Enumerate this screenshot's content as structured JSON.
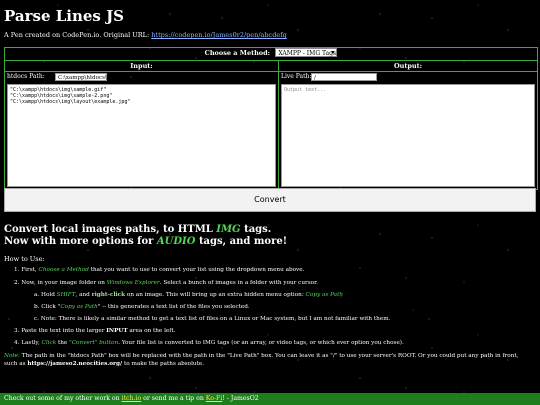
{
  "title": "Parse Lines JS",
  "credit": {
    "text": "A Pen created on CodePen.io. Original URL:",
    "url_text": "https://codepen.io/James0r2/pen/abcdefg"
  },
  "method": {
    "label": "Choose a Method:",
    "selected": "XAMPP - IMG Tags"
  },
  "input": {
    "header": "Input:",
    "path_label": "htdocs Path:",
    "path_value": "C:\\xampp\\htdocs\\",
    "lines": [
      "\"C:\\xampp\\htdocs\\img\\sample.gif\"",
      "\"C:\\xampp\\htdocs\\img\\sample-2.png\"",
      "\"C:\\xampp\\htdocs\\img\\layout\\example.jpg\""
    ]
  },
  "output": {
    "header": "Output:",
    "path_label": "Live Path:",
    "path_value": "/",
    "placeholder": "Output text..."
  },
  "convert_label": "Convert",
  "headline": {
    "line1_a": "Convert local images paths, to HTML",
    "line1_em": "IMG",
    "line1_b": "tags.",
    "line2_a": "Now with more options for",
    "line2_em": "AUDIO",
    "line2_b": "tags, and more!"
  },
  "how_to_use": "How to Use:",
  "steps": {
    "s1_a": "1. First,",
    "s1_em": "Choose a Method",
    "s1_b": "that you want to use to convert your list using the dropdown menu above.",
    "s2_a": "2. Now, in your image folder on",
    "s2_em": "Windows Explorer",
    "s2_b": ". Select a bunch of images in a folder with your cursor.",
    "sa_a": "a. Hold",
    "sa_key": "SHIFT",
    "sa_b": ", and",
    "sa_rc": "right-click",
    "sa_c": "on an image. This will bring up an extra hidden menu option:",
    "sa_em": "Copy as Path",
    "sb_a": "b. Click \"",
    "sb_em": "Copy as Path",
    "sb_b": "\" -- this generates a text list of the files you selected.",
    "sc": "c. Note: There is likely a similar method to get a text list of files on a Linux or Mac system, but I am not familiar with them.",
    "s3_a": "3. Paste the text into the larger",
    "s3_b": "INPUT",
    "s3_c": "area on the left.",
    "s4_a": "4. Lastly,",
    "s4_em": "Click",
    "s4_b": "the",
    "s4_em2": "\"Convert\" button",
    "s4_c": ". Your file list is converted to IMG tags (or an array, or video tags, or which ever option you chose)."
  },
  "note": {
    "label": "Note:",
    "text_a": "The path in the \"htdocs Path\" box will be replaced with the path in the \"Live Path\" box. You can leave it as \"/\" to use your server's ROOT. Or you could put any path in front, such as",
    "example": "https://jameso2.neocities.org/",
    "text_b": "to make the paths absolute."
  },
  "footer": {
    "text_a": "Check out some of my other work on",
    "link1": "itch.io",
    "text_b": "or send me a tip on",
    "link2": "Ko-Fi",
    "text_c": "! - JamesO2"
  }
}
